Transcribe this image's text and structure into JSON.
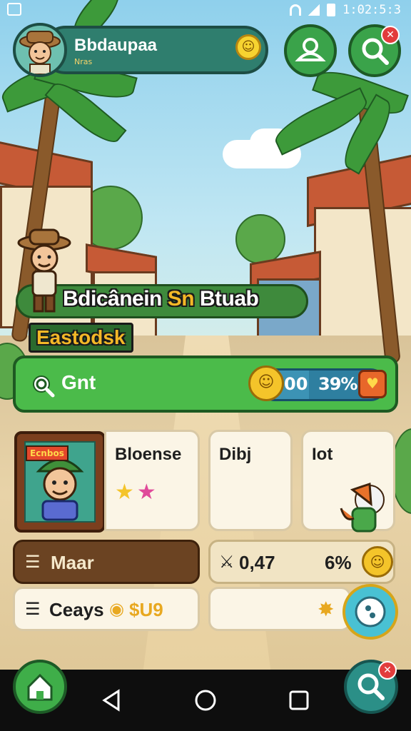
{
  "status_bar": {
    "time": "1:02:5:3"
  },
  "profile": {
    "name": "Bbdaupaa",
    "subtitle": "Nras"
  },
  "title": {
    "line_a": "Bdicânein ",
    "line_highlight": "Sn",
    "line_b": " Btuab",
    "subtitle": "Eastodsk"
  },
  "search_bar": {
    "label": "Gnt",
    "counter": "00",
    "percent": "39%",
    "progress": 0.39
  },
  "cards": [
    {
      "label": "Bloense",
      "portrait_tag": "Ecnbos"
    },
    {
      "label": "Dibj"
    },
    {
      "label": "Iot"
    }
  ],
  "rows": {
    "left_top": "Maar",
    "left_bottom": "Ceays",
    "left_bottom_value": "$U9",
    "right_top_value": "0,47",
    "right_top_percent": "6%"
  },
  "icons": {
    "profile_badge": "smiley-icon",
    "friends": "people-icon",
    "search": "search-icon",
    "heart": "heart-icon",
    "home": "home-icon",
    "back": "back-triangle-icon",
    "recent": "recent-square-icon"
  },
  "colors": {
    "accent_green": "#4bbb4a",
    "panel_teal": "#2f7e6e",
    "title_gold": "#f4b827",
    "badge_red": "#e23c3c"
  }
}
